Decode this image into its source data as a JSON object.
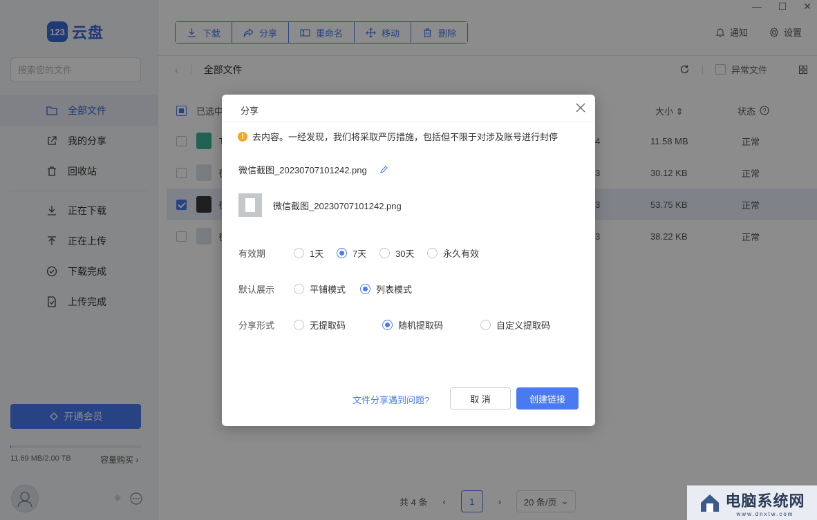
{
  "app": {
    "logo_mark": "123",
    "logo_text": "云盘"
  },
  "window": {
    "minimize": "—",
    "maximize": "☐",
    "close": "✕"
  },
  "search": {
    "placeholder": "搜索您的文件"
  },
  "sidebar": {
    "items": [
      {
        "label": "全部文件",
        "icon": "folder-icon",
        "active": true
      },
      {
        "label": "我的分享",
        "icon": "share-link-icon"
      },
      {
        "label": "回收站",
        "icon": "trash-icon"
      },
      {
        "label": "正在下载",
        "icon": "download-icon"
      },
      {
        "label": "正在上传",
        "icon": "upload-icon"
      },
      {
        "label": "下载完成",
        "icon": "check-circle-icon"
      },
      {
        "label": "上传完成",
        "icon": "doc-check-icon"
      }
    ],
    "vip_label": "开通会员",
    "quota_text": "11.69 MB/2.00 TB",
    "quota_fraction": 5.7e-06,
    "buy_label": "容量购买"
  },
  "toolbar": {
    "download": "下载",
    "share": "分享",
    "rename": "重命名",
    "move": "移动",
    "delete": "删除"
  },
  "topbar": {
    "notify": "通知",
    "settings": "设置"
  },
  "breadcrumb": {
    "current": "全部文件"
  },
  "tools": {
    "abnormal_label": "异常文件"
  },
  "table": {
    "selected_label": "已选中",
    "col_size": "大小",
    "col_status": "状态",
    "rows": [
      {
        "name": "T",
        "time_tail": "4",
        "size": "11.58 MB",
        "status": "正常",
        "selected": false
      },
      {
        "name": "微",
        "time_tail": "3",
        "size": "30.12 KB",
        "status": "正常",
        "selected": false
      },
      {
        "name": "微",
        "time_tail": "3",
        "size": "53.75 KB",
        "status": "正常",
        "selected": true
      },
      {
        "name": "微",
        "time_tail": "3",
        "size": "38.22 KB",
        "status": "正常",
        "selected": false
      }
    ]
  },
  "pager": {
    "total": "共 4 条",
    "page": "1",
    "page_size": "20 条/页"
  },
  "watermark": {
    "text": "电脑系统网",
    "sub": "www.dnxtw.com"
  },
  "dialog": {
    "title": "分享",
    "warning": "去内容。一经发现，我们将采取严厉措施，包括但不限于对涉及账号进行封停",
    "filename": "微信截图_20230707101242.png",
    "file_item": "微信截图_20230707101242.png",
    "validity": {
      "label": "有效期",
      "options": [
        "1天",
        "7天",
        "30天",
        "永久有效"
      ],
      "selected": "7天"
    },
    "display": {
      "label": "默认展示",
      "options": [
        "平铺模式",
        "列表模式"
      ],
      "selected": "列表模式"
    },
    "share_mode": {
      "label": "分享形式",
      "options": [
        "无提取码",
        "随机提取码",
        "自定义提取码"
      ],
      "selected": "随机提取码"
    },
    "help_link": "文件分享遇到问题?",
    "cancel": "取 消",
    "create": "创建链接"
  }
}
